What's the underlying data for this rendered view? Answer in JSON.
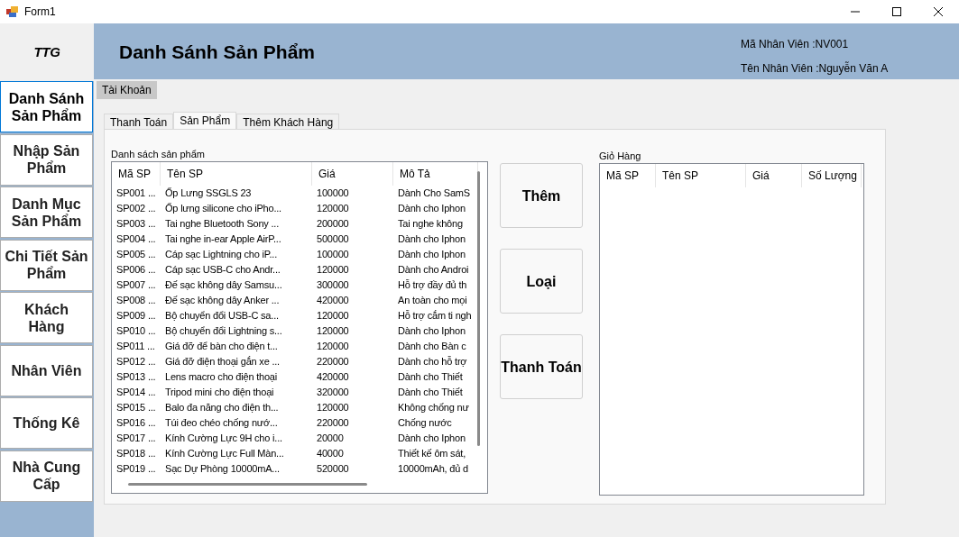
{
  "window": {
    "title": "Form1"
  },
  "header": {
    "logo": "TTG",
    "title": "Danh Sánh Sản Phẩm",
    "employee_id": "Mã Nhân Viên :NV001",
    "employee_name": "Tên Nhân Viên :Nguyễn Văn A"
  },
  "sidebar": {
    "items": [
      {
        "label": "Danh Sánh Sản Phẩm",
        "selected": true
      },
      {
        "label": "Nhập Sản Phẩm",
        "selected": false
      },
      {
        "label": "Danh Mục Sản Phẩm",
        "selected": false
      },
      {
        "label": "Chi Tiết Sản Phẩm",
        "selected": false
      },
      {
        "label": "Khách Hàng",
        "selected": false
      },
      {
        "label": "Nhân Viên",
        "selected": false
      },
      {
        "label": "Thống Kê",
        "selected": false
      },
      {
        "label": "Nhà Cung Cấp",
        "selected": false
      }
    ]
  },
  "menu": {
    "items": [
      "Tài Khoản"
    ]
  },
  "tabs": [
    {
      "label": "Thanh Toán",
      "selected": false
    },
    {
      "label": "Sản Phẩm",
      "selected": true
    },
    {
      "label": "Thêm Khách Hàng",
      "selected": false
    }
  ],
  "products": {
    "caption": "Danh sách sản phẩm",
    "columns": [
      "Mã SP",
      "Tên SP",
      "Giá",
      "Mô Tả"
    ],
    "rows": [
      [
        "SP001 ...",
        "Ốp Lưng SSGLS 23",
        "100000",
        "Dành Cho SamS"
      ],
      [
        "SP002 ...",
        "Ốp lưng silicone cho iPho...",
        "120000",
        "Dành cho Iphon"
      ],
      [
        "SP003 ...",
        "Tai nghe Bluetooth Sony ...",
        "200000",
        "Tai nghe không"
      ],
      [
        "SP004 ...",
        "Tai nghe in-ear Apple AirP...",
        "500000",
        "Dành cho Iphon"
      ],
      [
        "SP005 ...",
        "Cáp sạc Lightning cho iP...",
        "100000",
        "Dành cho Iphon"
      ],
      [
        "SP006 ...",
        "Cáp sạc USB-C cho Andr...",
        "120000",
        "Dành cho Androi"
      ],
      [
        "SP007 ...",
        "Đế sạc không dây Samsu...",
        "300000",
        "Hỗ trợ đầy đủ th"
      ],
      [
        "SP008 ...",
        "Đế sạc không dây Anker ...",
        "420000",
        "An toàn cho mọi"
      ],
      [
        "SP009 ...",
        "Bộ chuyển đổi USB-C sa...",
        "120000",
        "Hỗ trợ cắm ti ngh"
      ],
      [
        "SP010 ...",
        "Bộ chuyển đổi Lightning s...",
        "120000",
        "Dành cho Iphon"
      ],
      [
        "SP011 ...",
        "Giá đỡ để bàn cho điện t...",
        "120000",
        "Dành cho Bàn c"
      ],
      [
        "SP012 ...",
        "Giá đỡ điện thoại gắn xe ...",
        "220000",
        "Dành cho hỗ trợ"
      ],
      [
        "SP013 ...",
        "Lens macro cho điện thoại",
        "420000",
        "Dành cho Thiết"
      ],
      [
        "SP014 ...",
        "Tripod mini cho điện thoại",
        "320000",
        "Dành cho Thiết"
      ],
      [
        "SP015 ...",
        "Balo đa năng cho điện th...",
        "120000",
        "Không chống nư"
      ],
      [
        "SP016 ...",
        "Túi đeo chéo chống nướ...",
        "220000",
        "Chống nước"
      ],
      [
        "SP017 ...",
        "Kính Cường Lực 9H cho i...",
        "20000",
        "Dành cho Iphon"
      ],
      [
        "SP018 ...",
        "Kính Cường Lực Full Màn...",
        "40000",
        "Thiết kế ôm sát,"
      ],
      [
        "SP019 ...",
        "Sạc Dự Phòng 10000mA...",
        "520000",
        "10000mAh, đủ d"
      ]
    ]
  },
  "actions": [
    "Thêm",
    "Loại",
    "Thanh Toán"
  ],
  "cart": {
    "caption": "Giỏ Hàng",
    "columns": [
      "Mã SP",
      "Tên SP",
      "Giá",
      "Số Lượng"
    ]
  }
}
